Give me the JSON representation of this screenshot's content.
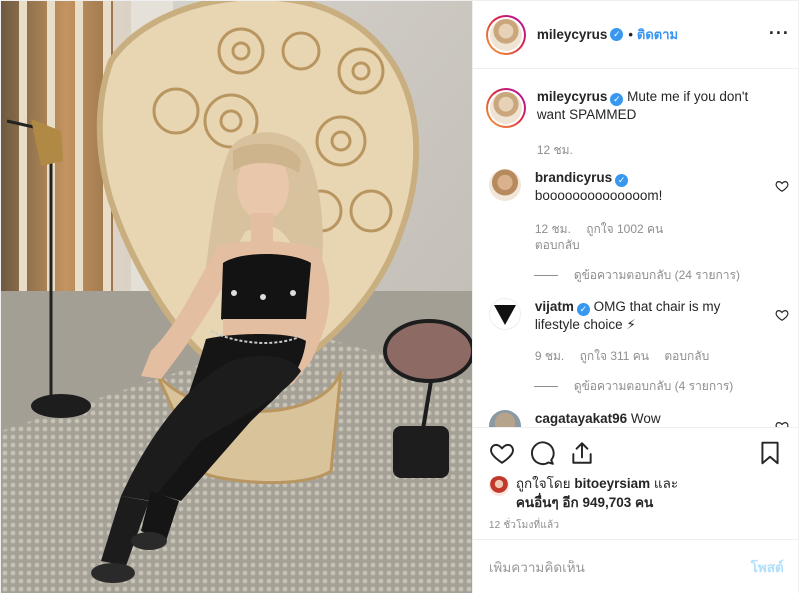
{
  "colors": {
    "accent": "#3897f0",
    "muted": "#8e8e8e",
    "post_disabled": "#b2dffc",
    "verified": "#3897f0"
  },
  "header": {
    "username": "mileycyrus",
    "separator": "•",
    "follow_label": "ติดตาม",
    "more_icon": "ellipsis-icon",
    "more_glyph": "···"
  },
  "caption": {
    "username": "mileycyrus",
    "text": "Mute me if you don't want SPAMMED",
    "time": "12 ชม."
  },
  "comments": [
    {
      "username": "brandicyrus",
      "verified": true,
      "text": "boooooooooooooom!",
      "time": "12 ชม.",
      "likes": "ถูกใจ 1002 คน",
      "reply": "ตอบกลับ",
      "view_replies": "ดูข้อความตอบกลับ (24 รายการ)"
    },
    {
      "username": "vijatm",
      "verified": true,
      "text": "OMG that chair is my lifestyle choice ⚡",
      "time": "9 ชม.",
      "likes": "ถูกใจ 311 คน",
      "reply": "ตอบกลับ",
      "view_replies": "ดูข้อความตอบกลับ (4 รายการ)"
    },
    {
      "username": "cagatayakat96",
      "verified": false,
      "text": "Wow"
    }
  ],
  "likes": {
    "line1_prefix": "ถูกใจโดย ",
    "liked_by": "bitoeyrsiam",
    "line1_suffix": " และ",
    "line2_prefix": "คนอื่นๆ อีก ",
    "count": "949,703 คน"
  },
  "timestamp": "12 ชั่วโมงที่แล้ว",
  "add_comment": {
    "placeholder": "เพิ่มความคิดเห็น",
    "post_label": "โพสต์"
  },
  "icons": {
    "like": "heart-icon",
    "comment": "comment-icon",
    "share": "share-icon",
    "save": "bookmark-icon"
  }
}
